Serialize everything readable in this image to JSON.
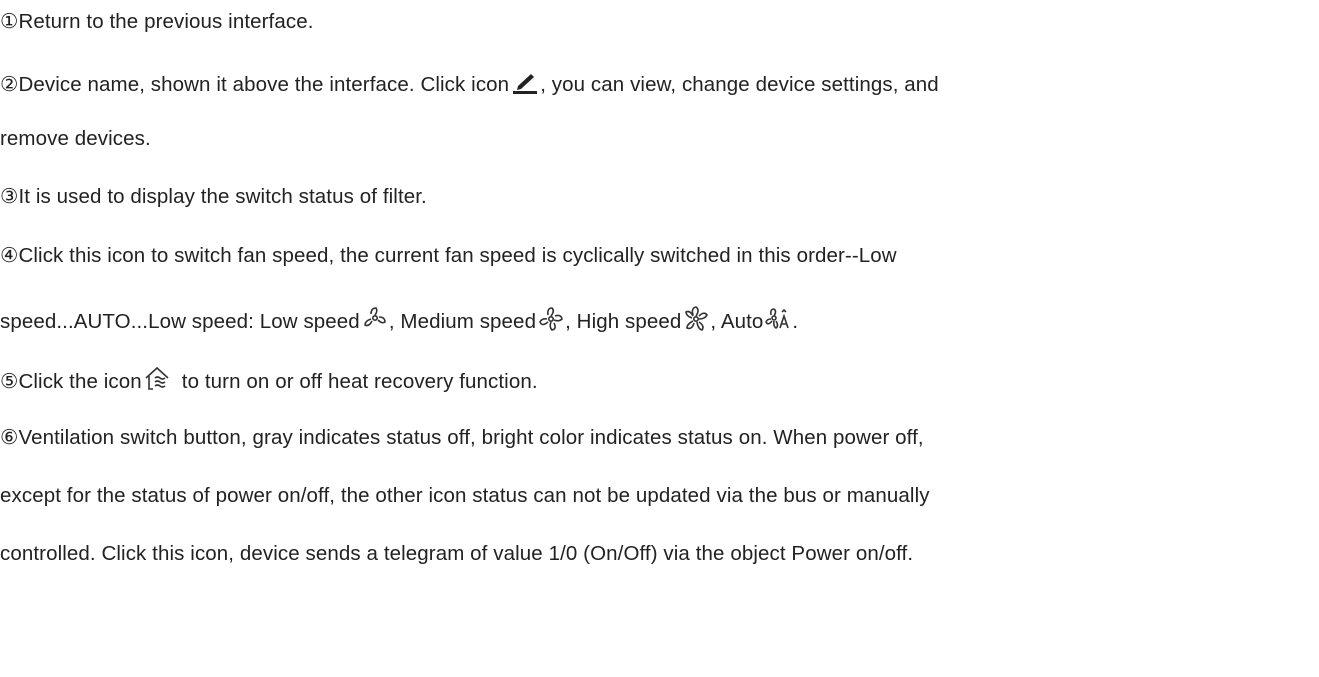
{
  "doc": {
    "p1": "①Return to the previous interface.",
    "p2a": "②Device name, shown it above the interface. Click icon",
    "p2b": ", you can view, change device settings, and",
    "p2c": "remove devices.",
    "p3": "③It is used to display the switch status of filter.",
    "p4a": "④Click this icon to switch fan speed, the current fan speed is cyclically switched in this order--Low",
    "p4b": "speed...AUTO...Low speed: Low speed",
    "p4c": ", Medium speed",
    "p4d": ", High speed",
    "p4e": ", Auto",
    "p4f": ".",
    "p5a": "⑤Click the icon",
    "p5b": "to turn on or off heat recovery function.",
    "p6a": "⑥Ventilation switch button, gray indicates status off, bright color indicates status on. When power off,",
    "p6b": "except for the status of power on/off, the other icon status can not be updated via the bus or manually",
    "p6c": "controlled. Click this icon, device sends a telegram of value 1/0 (On/Off) via the object Power on/off."
  },
  "icons": {
    "edit": "pencil-edit-icon",
    "fan_low": "fan-low-speed-icon",
    "fan_medium": "fan-medium-speed-icon",
    "fan_high": "fan-high-speed-icon",
    "fan_auto": "fan-auto-icon",
    "heat_recovery": "heat-recovery-icon"
  },
  "colors": {
    "text": "#222222",
    "icon": "#333333"
  }
}
